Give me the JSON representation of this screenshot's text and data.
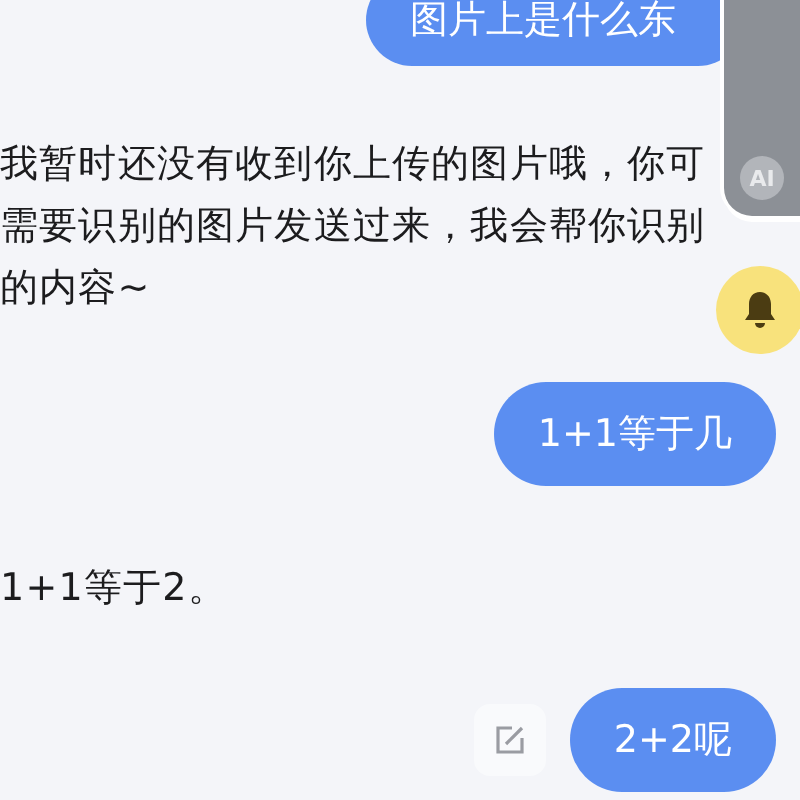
{
  "messages": [
    {
      "kind": "user",
      "text": "图片上是什么东"
    },
    {
      "kind": "assistant",
      "lines": [
        "我暂时还没有收到你上传的图片哦，你可",
        "需要识别的图片发送过来，我会帮你识别",
        "的内容~"
      ]
    },
    {
      "kind": "user",
      "text": "1+1等于几"
    },
    {
      "kind": "assistant",
      "lines": [
        "1+1等于2。"
      ]
    },
    {
      "kind": "user",
      "text": "2+2呢",
      "editable": true
    }
  ],
  "floating_panel": {
    "badge": "AI"
  }
}
